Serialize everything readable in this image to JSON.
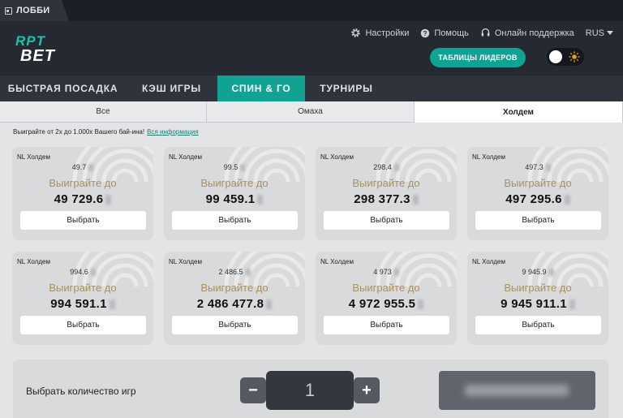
{
  "titlebar": {
    "tab_label": "ЛОББИ"
  },
  "header": {
    "logo_text_top": "RPT",
    "logo_text_bottom": "BET",
    "settings_label": "Настройки",
    "help_label": "Помощь",
    "support_label": "Онлайн поддержка",
    "language": "RUS",
    "leaders_button": "ТАБЛИЦЫ ЛИДЕРОВ"
  },
  "nav": {
    "tabs": [
      {
        "label": "БЫСТРАЯ ПОСАДКА",
        "active": false
      },
      {
        "label": "КЭШ ИГРЫ",
        "active": false
      },
      {
        "label": "СПИН & ГО",
        "active": true
      },
      {
        "label": "ТУРНИРЫ",
        "active": false
      }
    ]
  },
  "subtabs": [
    {
      "label": "Все",
      "active": false
    },
    {
      "label": "Омаха",
      "active": false
    },
    {
      "label": "Холдем",
      "active": true
    }
  ],
  "info": {
    "text": "Выиграйте от 2x до 1.000x Вашего бай-ина!",
    "link": "Вся информация"
  },
  "cards": [
    {
      "game": "NL Холдем",
      "buyin": "49.7",
      "win_label": "Выиграйте до",
      "prize": "49 729.6",
      "button": "Выбрать"
    },
    {
      "game": "NL Холдем",
      "buyin": "99.5",
      "win_label": "Выиграйте до",
      "prize": "99 459.1",
      "button": "Выбрать"
    },
    {
      "game": "NL Холдем",
      "buyin": "298.4",
      "win_label": "Выиграйте до",
      "prize": "298 377.3",
      "button": "Выбрать"
    },
    {
      "game": "NL Холдем",
      "buyin": "497.3",
      "win_label": "Выиграйте до",
      "prize": "497 295.6",
      "button": "Выбрать"
    },
    {
      "game": "NL Холдем",
      "buyin": "994.6",
      "win_label": "Выиграйте до",
      "prize": "994 591.1",
      "button": "Выбрать"
    },
    {
      "game": "NL Холдем",
      "buyin": "2 486.5",
      "win_label": "Выиграйте до",
      "prize": "2 486 477.8",
      "button": "Выбрать"
    },
    {
      "game": "NL Холдем",
      "buyin": "4 973",
      "win_label": "Выиграйте до",
      "prize": "4 972 955.5",
      "button": "Выбрать"
    },
    {
      "game": "NL Холдем",
      "buyin": "9 945.9",
      "win_label": "Выиграйте до",
      "prize": "9 945 911.1",
      "button": "Выбрать"
    }
  ],
  "bottom": {
    "label": "Выбрать количество игр",
    "minus": "−",
    "count": "1",
    "plus": "+"
  },
  "colors": {
    "accent": "#10a394",
    "header_bg": "#252932",
    "win_label": "#a89060"
  },
  "icons": {
    "settings": "gear-icon",
    "help": "help-circle-icon",
    "support": "headset-icon",
    "lobby": "window-icon",
    "theme": "sun-icon"
  }
}
